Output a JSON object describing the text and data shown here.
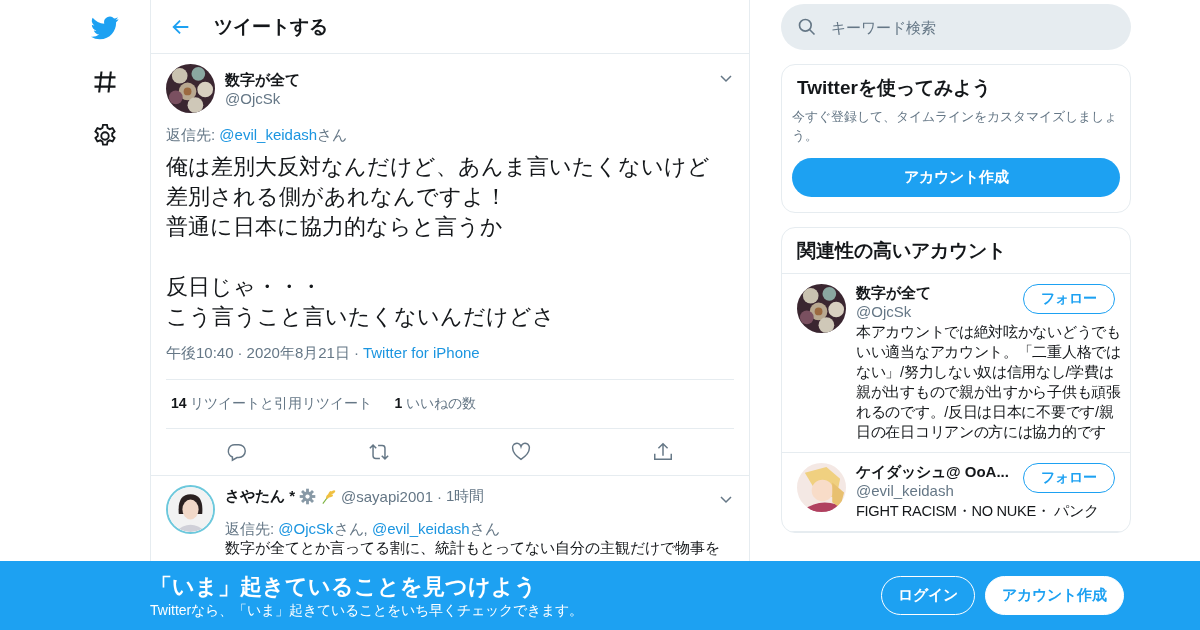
{
  "nav": {
    "items": [
      {
        "kind": "logo"
      },
      {
        "kind": "explore"
      },
      {
        "kind": "settings"
      }
    ]
  },
  "header": {
    "title": "ツイートする"
  },
  "tweet": {
    "name": "数字が全て",
    "handle": "@OjcSk",
    "reply_to": [
      {
        "kind": "plain",
        "text": "返信先: "
      },
      {
        "kind": "link",
        "text": "@evil_keidash"
      },
      {
        "kind": "plain",
        "text": "さん"
      }
    ],
    "paragraphs": [
      [
        "俺は差別大反対なんだけど、あんま言いたくないけど",
        "差別される側があれなんですよ！",
        "普通に日本に協力的ならと言うか"
      ],
      [
        "反日じゃ・・・",
        "こう言うこと言いたくないんだけどさ"
      ]
    ],
    "meta": [
      {
        "kind": "plain",
        "text": "午後10:40"
      },
      {
        "kind": "sep",
        "text": "·"
      },
      {
        "kind": "plain",
        "text": "2020年8月21日"
      },
      {
        "kind": "sep",
        "text": "·"
      },
      {
        "kind": "link",
        "text": "Twitter for iPhone"
      }
    ],
    "stats": [
      "**14** リツイートと引用リツイート",
      "**1** いいねの数"
    ],
    "actions": [
      {
        "kind": "reply"
      },
      {
        "kind": "retweet"
      },
      {
        "kind": "like"
      },
      {
        "kind": "share"
      }
    ]
  },
  "reply": {
    "name": "さやたん *",
    "handle": "@sayapi2001",
    "sep": "·",
    "time": "1時間",
    "reply_to": [
      {
        "kind": "plain",
        "text": "返信先: "
      },
      {
        "kind": "link",
        "text": "@OjcSk"
      },
      {
        "kind": "plain",
        "text": "さん, "
      },
      {
        "kind": "link",
        "text": "@evil_keidash"
      },
      {
        "kind": "plain",
        "text": "さん"
      }
    ],
    "body": "数字が全てとか言ってる割に、統計もとってない自分の主観だけで物事を"
  },
  "search": {
    "placeholder": "キーワード検索"
  },
  "signup_card": {
    "title": "Twitterを使ってみよう",
    "text": "今すぐ登録して、タイムラインをカスタマイズしましょう。",
    "button": "アカウント作成"
  },
  "related": {
    "title": "関連性の高いアカウント",
    "accounts": [
      {
        "name": "数字が全て",
        "handle": "@OjcSk",
        "button": "フォロー",
        "bio": "本アカウントでは絶対呟かないどうでもいい適当なアカウント。「二重人格ではない」/努力しない奴は信用なし/学費は親が出すもので親が出すから子供も頑張れるのです。/反日は日本に不要です/親日の在日コリアンの方には協力的です"
      },
      {
        "name": "ケイダッシュ@ OoA...",
        "handle": "@evil_keidash",
        "button": "フォロー",
        "bio": "FIGHT RACISM・NO NUKE・ パンク"
      }
    ]
  },
  "banner": {
    "title": "「いま」起きていることを見つけよう",
    "subtitle": "Twitterなら、「いま」起きていることをいち早くチェックできます。",
    "buttons": [
      {
        "kind": "outline",
        "label": "ログイン"
      },
      {
        "kind": "filled",
        "label": "アカウント作成"
      }
    ]
  }
}
